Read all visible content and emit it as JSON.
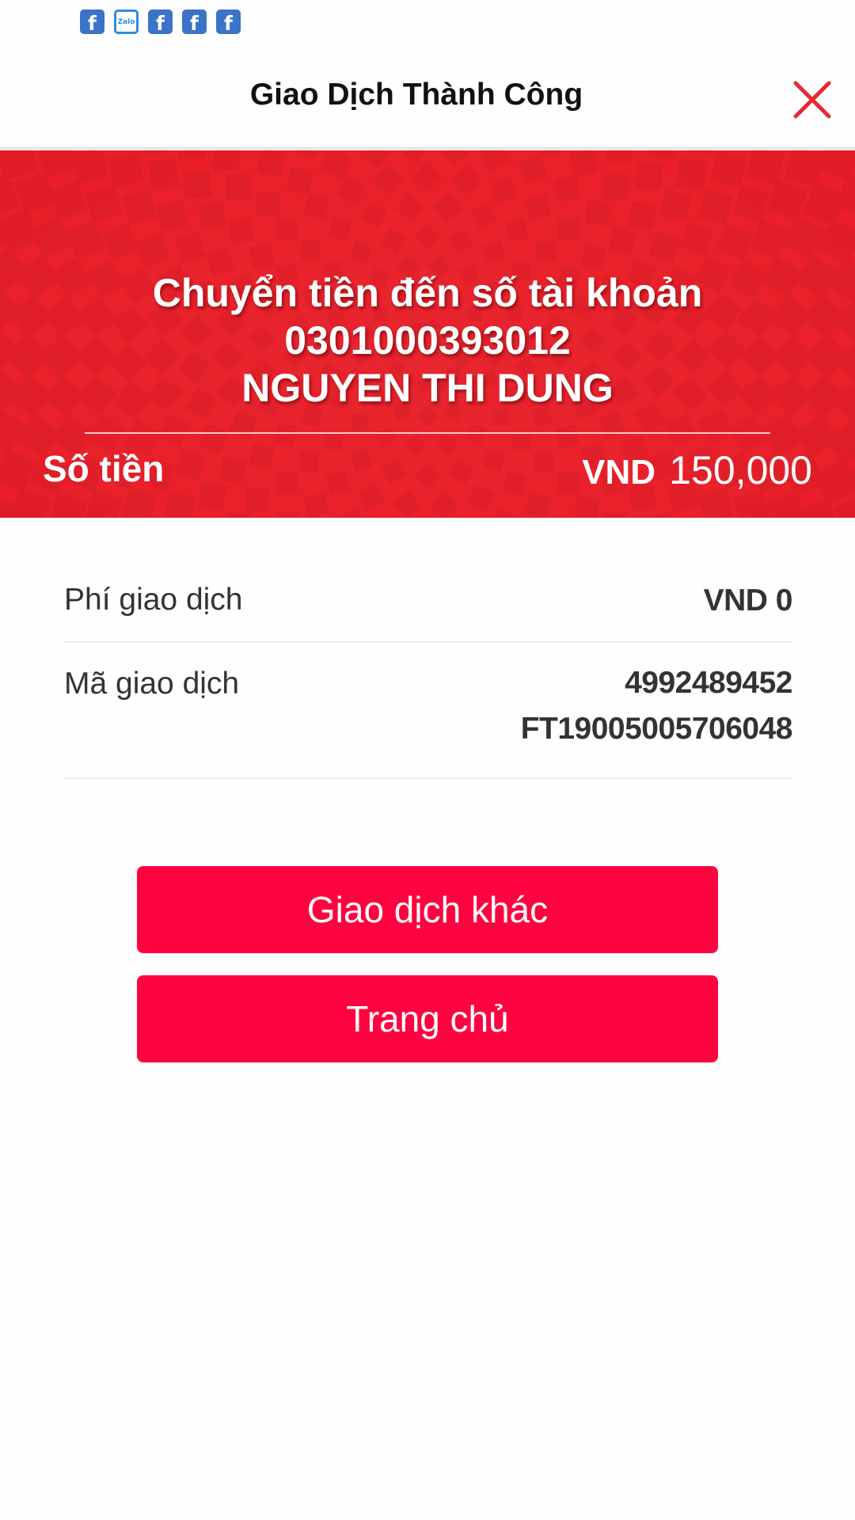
{
  "status_bar": {
    "notification_icons": [
      {
        "type": "facebook-icon",
        "glyph": "f"
      },
      {
        "type": "zalo-icon",
        "glyph": "Zalo"
      },
      {
        "type": "facebook-icon",
        "glyph": "f"
      },
      {
        "type": "facebook-icon",
        "glyph": "f"
      },
      {
        "type": "facebook-icon",
        "glyph": "f"
      }
    ]
  },
  "header": {
    "title": "Giao Dịch Thành Công",
    "close_icon": "close-icon"
  },
  "banner": {
    "line1": "Chuyển tiền đến số tài khoản",
    "account_number": "0301000393012",
    "account_name": "NGUYEN THI DUNG",
    "amount_label": "Số tiền",
    "currency": "VND",
    "amount": "150,000"
  },
  "details": {
    "fee_label": "Phí giao dịch",
    "fee_value": "VND 0",
    "code_label": "Mã giao dịch",
    "code_value_1": "4992489452",
    "code_value_2": "FT19005005706048"
  },
  "buttons": {
    "other_transaction": "Giao dịch khác",
    "home": "Trang chủ"
  },
  "colors": {
    "banner_red": "#e5212b",
    "button_red": "#ff0340",
    "close_red": "#e52a2f",
    "facebook_blue": "#3b73c8",
    "zalo_blue": "#2f8ce0"
  }
}
